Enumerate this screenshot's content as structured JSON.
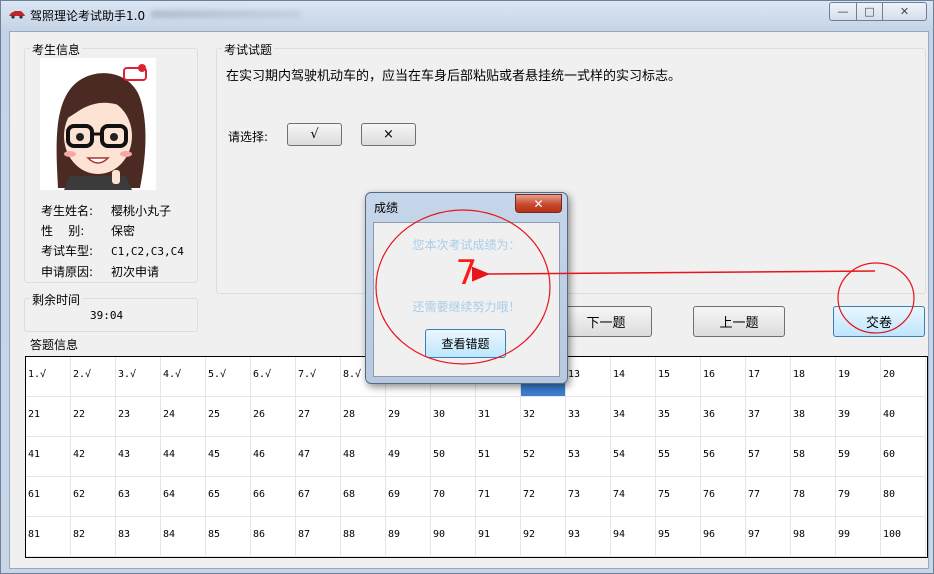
{
  "window": {
    "title": "驾照理论考试助手1.0",
    "buttons": {
      "minimize": "—",
      "maximize": "□",
      "close": "✕"
    }
  },
  "examinee": {
    "group_label": "考生信息",
    "rows": [
      {
        "key": "考生姓名:",
        "value": "樱桃小丸子"
      },
      {
        "key": "性    别:",
        "value": "保密"
      },
      {
        "key": "考试车型:",
        "value": "C1,C2,C3,C4"
      },
      {
        "key": "申请原因:",
        "value": "初次申请"
      }
    ]
  },
  "timer": {
    "group_label": "剩余时间",
    "value": "39:04"
  },
  "question": {
    "group_label": "考试试题",
    "text": "在实习期内驾驶机动车的，应当在车身后部粘贴或者悬挂统一式样的实习标志。",
    "choose_label": "请选择:",
    "options": [
      "√",
      "×"
    ]
  },
  "nav": {
    "next": "下一题",
    "prev": "上一题",
    "submit": "交卷"
  },
  "answers": {
    "group_label": "答题信息",
    "cells": [
      "1.√",
      "2.√",
      "3.√",
      "4.√",
      "5.√",
      "6.√",
      "7.√",
      "8.√",
      "",
      "",
      "",
      "",
      "13",
      "14",
      "15",
      "16",
      "17",
      "18",
      "19",
      "20",
      "21",
      "22",
      "23",
      "24",
      "25",
      "26",
      "27",
      "28",
      "29",
      "30",
      "31",
      "32",
      "33",
      "34",
      "35",
      "36",
      "37",
      "38",
      "39",
      "40",
      "41",
      "42",
      "43",
      "44",
      "45",
      "46",
      "47",
      "48",
      "49",
      "50",
      "51",
      "52",
      "53",
      "54",
      "55",
      "56",
      "57",
      "58",
      "59",
      "60",
      "61",
      "62",
      "63",
      "64",
      "65",
      "66",
      "67",
      "68",
      "69",
      "70",
      "71",
      "72",
      "73",
      "74",
      "75",
      "76",
      "77",
      "78",
      "79",
      "80",
      "81",
      "82",
      "83",
      "84",
      "85",
      "86",
      "87",
      "88",
      "89",
      "90",
      "91",
      "92",
      "93",
      "94",
      "95",
      "96",
      "97",
      "98",
      "99",
      "100"
    ],
    "current_question": 12
  },
  "dialog": {
    "title": "成绩",
    "prefix": "您本次考试成绩为：",
    "score": "7",
    "suffix": "还需要继续努力哦！",
    "review_button": "查看错题",
    "close": "✕"
  },
  "colors": {
    "annotation": "#e8141c",
    "score": "#ff1a1a",
    "hint_text": "#a8cde9",
    "selected_cell": "#3c7fd0"
  }
}
